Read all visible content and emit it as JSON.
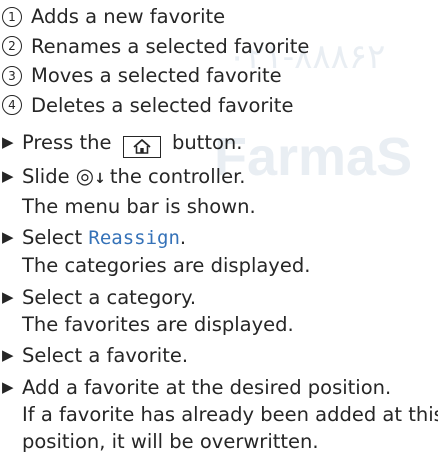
{
  "watermark": {
    "number": "۰۲۱-۸۸۸۶۲",
    "brand": "FarmaS"
  },
  "legend": [
    {
      "num": "1",
      "text": "Adds a new favorite"
    },
    {
      "num": "2",
      "text": "Renames a selected favorite"
    },
    {
      "num": "3",
      "text": "Moves a selected favorite"
    },
    {
      "num": "4",
      "text": "Deletes a selected favorite"
    }
  ],
  "steps": {
    "s1": {
      "before": "Press the",
      "icon": "home-icon",
      "after": "button."
    },
    "s2": {
      "before": "Slide",
      "control": "controller-icon",
      "after": "the controller.",
      "result": "The menu bar is shown."
    },
    "s3": {
      "before": "Select",
      "term": "Reassign",
      "after": ".",
      "result": "The categories are displayed."
    },
    "s4": {
      "text": "Select a category.",
      "result": "The favorites are displayed."
    },
    "s5": {
      "text": "Select a favorite."
    },
    "s6": {
      "text": "Add a favorite at the desired position.",
      "result_1": "If a favorite has already been added at this",
      "result_2": "position, it will be overwritten."
    }
  },
  "colors": {
    "text": "#262626",
    "menu_term": "#3572b8",
    "watermark": "#e9eef3"
  }
}
